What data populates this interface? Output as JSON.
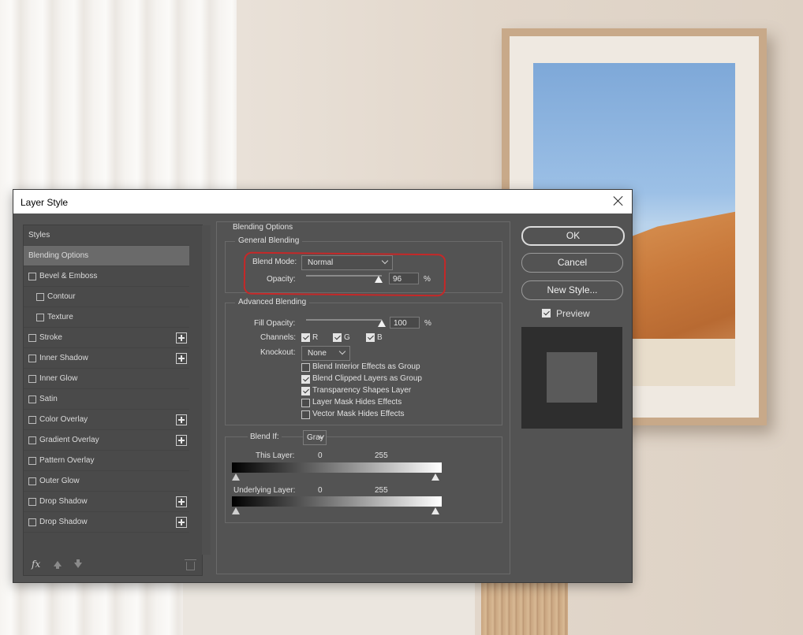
{
  "dialog": {
    "title": "Layer Style",
    "close_icon": "close-icon"
  },
  "styles_list": {
    "header": "Styles",
    "items": [
      {
        "label": "Blending Options",
        "checkbox": false,
        "plus": false,
        "selected": true,
        "indent": 0
      },
      {
        "label": "Bevel & Emboss",
        "checkbox": true,
        "checked": false,
        "plus": false,
        "indent": 0
      },
      {
        "label": "Contour",
        "checkbox": true,
        "checked": false,
        "plus": false,
        "indent": 1
      },
      {
        "label": "Texture",
        "checkbox": true,
        "checked": false,
        "plus": false,
        "indent": 1
      },
      {
        "label": "Stroke",
        "checkbox": true,
        "checked": false,
        "plus": true,
        "indent": 0
      },
      {
        "label": "Inner Shadow",
        "checkbox": true,
        "checked": false,
        "plus": true,
        "indent": 0
      },
      {
        "label": "Inner Glow",
        "checkbox": true,
        "checked": false,
        "plus": false,
        "indent": 0
      },
      {
        "label": "Satin",
        "checkbox": true,
        "checked": false,
        "plus": false,
        "indent": 0
      },
      {
        "label": "Color Overlay",
        "checkbox": true,
        "checked": false,
        "plus": true,
        "indent": 0
      },
      {
        "label": "Gradient Overlay",
        "checkbox": true,
        "checked": false,
        "plus": true,
        "indent": 0
      },
      {
        "label": "Pattern Overlay",
        "checkbox": true,
        "checked": false,
        "plus": false,
        "indent": 0
      },
      {
        "label": "Outer Glow",
        "checkbox": true,
        "checked": false,
        "plus": false,
        "indent": 0
      },
      {
        "label": "Drop Shadow",
        "checkbox": true,
        "checked": false,
        "plus": true,
        "indent": 0
      },
      {
        "label": "Drop Shadow",
        "checkbox": true,
        "checked": false,
        "plus": true,
        "indent": 0
      }
    ],
    "footer": {
      "fx_label": "fx"
    }
  },
  "blending": {
    "section_title": "Blending Options",
    "general": {
      "title": "General Blending",
      "blend_mode_label": "Blend Mode:",
      "blend_mode_value": "Normal",
      "opacity_label": "Opacity:",
      "opacity_value": "96",
      "opacity_unit": "%",
      "opacity_fraction": 0.96
    },
    "advanced": {
      "title": "Advanced Blending",
      "fill_opacity_label": "Fill Opacity:",
      "fill_opacity_value": "100",
      "fill_opacity_unit": "%",
      "fill_opacity_fraction": 1.0,
      "channels_label": "Channels:",
      "channels": [
        {
          "label": "R",
          "checked": true
        },
        {
          "label": "G",
          "checked": true
        },
        {
          "label": "B",
          "checked": true
        }
      ],
      "knockout_label": "Knockout:",
      "knockout_value": "None",
      "options": [
        {
          "label": "Blend Interior Effects as Group",
          "checked": false
        },
        {
          "label": "Blend Clipped Layers as Group",
          "checked": true
        },
        {
          "label": "Transparency Shapes Layer",
          "checked": true
        },
        {
          "label": "Layer Mask Hides Effects",
          "checked": false
        },
        {
          "label": "Vector Mask Hides Effects",
          "checked": false
        }
      ]
    },
    "blend_if": {
      "label": "Blend If:",
      "value": "Gray",
      "this_layer": {
        "label": "This Layer:",
        "low": "0",
        "high": "255"
      },
      "underlying_layer": {
        "label": "Underlying Layer:",
        "low": "0",
        "high": "255"
      }
    }
  },
  "buttons": {
    "ok": "OK",
    "cancel": "Cancel",
    "new_style": "New Style...",
    "preview_label": "Preview",
    "preview_checked": true
  },
  "colors": {
    "dialog_bg": "#535353",
    "highlight": "#c62828"
  }
}
